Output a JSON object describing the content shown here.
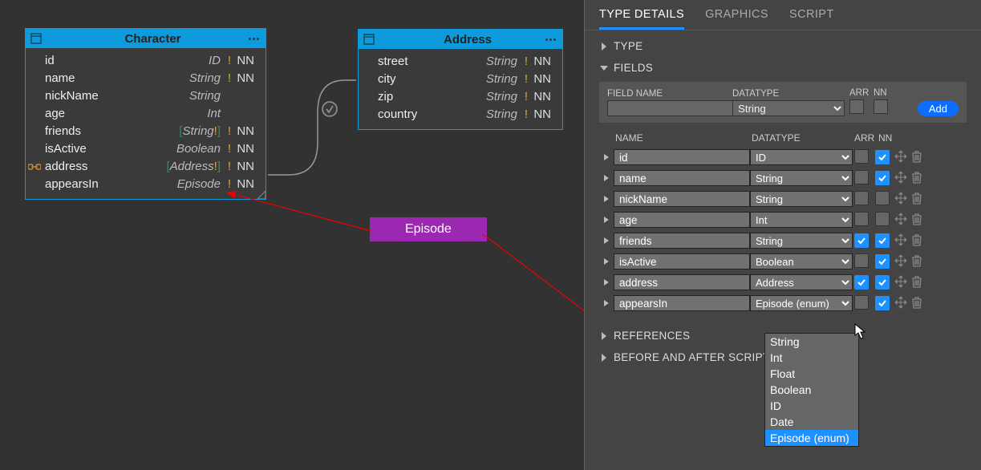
{
  "canvas": {
    "character": {
      "title": "Character",
      "fields": [
        {
          "name": "id",
          "type": "ID",
          "bang": "!",
          "nn": "NN",
          "link": false
        },
        {
          "name": "name",
          "type": "String",
          "bang": "!",
          "nn": "NN",
          "link": false
        },
        {
          "name": "nickName",
          "type": "String",
          "bang": "",
          "nn": "",
          "link": false
        },
        {
          "name": "age",
          "type": "Int",
          "bang": "",
          "nn": "",
          "link": false
        },
        {
          "name": "friends",
          "pre": "[",
          "type": "String",
          "typeBang": "!",
          "post": "]",
          "bang": "!",
          "nn": "NN",
          "link": false
        },
        {
          "name": "isActive",
          "type": "Boolean",
          "bang": "!",
          "nn": "NN",
          "link": false
        },
        {
          "name": "address",
          "pre": "[",
          "type": "Address",
          "typeBang": "!",
          "post": "]",
          "bang": "!",
          "nn": "NN",
          "link": true
        },
        {
          "name": "appearsIn",
          "type": "Episode",
          "bang": "!",
          "nn": "NN",
          "link": false
        }
      ]
    },
    "address": {
      "title": "Address",
      "fields": [
        {
          "name": "street",
          "type": "String",
          "bang": "!",
          "nn": "NN"
        },
        {
          "name": "city",
          "type": "String",
          "bang": "!",
          "nn": "NN"
        },
        {
          "name": "zip",
          "type": "String",
          "bang": "!",
          "nn": "NN"
        },
        {
          "name": "country",
          "type": "String",
          "bang": "!",
          "nn": "NN"
        }
      ]
    },
    "enum": {
      "title": "Episode"
    }
  },
  "panel": {
    "tabs": [
      "TYPE DETAILS",
      "GRAPHICS",
      "SCRIPT"
    ],
    "activeTab": 0,
    "sections": {
      "type": "TYPE",
      "fields": "FIELDS",
      "references": "REFERENCES",
      "scripts": "BEFORE AND AFTER SCRIPTS"
    },
    "newField": {
      "labels": {
        "name": "FIELD NAME",
        "datatype": "DATATYPE",
        "arr": "ARR",
        "nn": "NN"
      },
      "name": "",
      "datatype": "String",
      "arr": false,
      "nn": false,
      "addBtn": "Add"
    },
    "fieldsHeader": {
      "name": "NAME",
      "datatype": "DATATYPE",
      "arr": "ARR",
      "nn": "NN"
    },
    "fields": [
      {
        "name": "id",
        "datatype": "ID",
        "arr": false,
        "nn": true
      },
      {
        "name": "name",
        "datatype": "String",
        "arr": false,
        "nn": true
      },
      {
        "name": "nickName",
        "datatype": "String",
        "arr": false,
        "nn": false
      },
      {
        "name": "age",
        "datatype": "Int",
        "arr": false,
        "nn": false
      },
      {
        "name": "friends",
        "datatype": "String",
        "arr": true,
        "nn": true
      },
      {
        "name": "isActive",
        "datatype": "Boolean",
        "arr": false,
        "nn": true
      },
      {
        "name": "address",
        "datatype": "Address",
        "arr": true,
        "nn": true
      },
      {
        "name": "appearsIn",
        "datatype": "Episode (enum)",
        "arr": false,
        "nn": true
      }
    ],
    "dropdownOptions": [
      "String",
      "Int",
      "Float",
      "Boolean",
      "ID",
      "Date",
      "Episode (enum)"
    ],
    "dropdownSelectedIndex": 6
  }
}
